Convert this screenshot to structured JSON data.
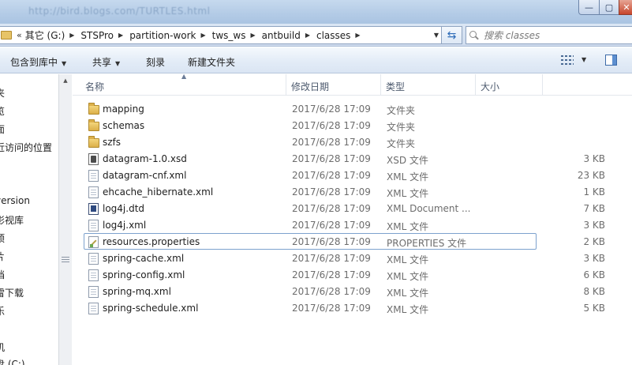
{
  "window": {
    "title": "http://bird.blogs.com/TURTLES.html",
    "controls": {
      "minimize": "—",
      "maximize": "▢",
      "close": "✕"
    }
  },
  "address": {
    "prefix": "«",
    "crumbs": [
      "其它 (G:)",
      "STSPro",
      "partition-work",
      "tws_ws",
      "antbuild",
      "classes"
    ]
  },
  "search": {
    "placeholder": "搜索 classes"
  },
  "toolbar": {
    "include_library": "包含到库中",
    "share": "共享",
    "burn": "刻录",
    "new_folder": "新建文件夹"
  },
  "nav": {
    "items": [
      "夹",
      "览",
      "面",
      "近访问的位置",
      "version",
      "影视库",
      "顶",
      "片",
      "档",
      "雷下载",
      "乐",
      "机",
      "盘 (C:)"
    ]
  },
  "columns": {
    "name": "名称",
    "date": "修改日期",
    "type": "类型",
    "size": "大小"
  },
  "files": [
    {
      "icon": "folder-icon",
      "name": "mapping",
      "date": "2017/6/28 17:09",
      "type": "文件夹",
      "size": ""
    },
    {
      "icon": "folder-icon",
      "name": "schemas",
      "date": "2017/6/28 17:09",
      "type": "文件夹",
      "size": ""
    },
    {
      "icon": "folder-icon",
      "name": "szfs",
      "date": "2017/6/28 17:09",
      "type": "文件夹",
      "size": ""
    },
    {
      "icon": "xsd-file-icon",
      "name": "datagram-1.0.xsd",
      "date": "2017/6/28 17:09",
      "type": "XSD 文件",
      "size": "3 KB"
    },
    {
      "icon": "xml-file-icon",
      "name": "datagram-cnf.xml",
      "date": "2017/6/28 17:09",
      "type": "XML 文件",
      "size": "23 KB"
    },
    {
      "icon": "xml-file-icon",
      "name": "ehcache_hibernate.xml",
      "date": "2017/6/28 17:09",
      "type": "XML 文件",
      "size": "1 KB"
    },
    {
      "icon": "dtd-file-icon",
      "name": "log4j.dtd",
      "date": "2017/6/28 17:09",
      "type": "XML Document ...",
      "size": "7 KB"
    },
    {
      "icon": "xml-file-icon",
      "name": "log4j.xml",
      "date": "2017/6/28 17:09",
      "type": "XML 文件",
      "size": "3 KB"
    },
    {
      "icon": "properties-file-icon",
      "name": "resources.properties",
      "date": "2017/6/28 17:09",
      "type": "PROPERTIES 文件",
      "size": "2 KB"
    },
    {
      "icon": "xml-file-icon",
      "name": "spring-cache.xml",
      "date": "2017/6/28 17:09",
      "type": "XML 文件",
      "size": "3 KB"
    },
    {
      "icon": "xml-file-icon",
      "name": "spring-config.xml",
      "date": "2017/6/28 17:09",
      "type": "XML 文件",
      "size": "6 KB"
    },
    {
      "icon": "xml-file-icon",
      "name": "spring-mq.xml",
      "date": "2017/6/28 17:09",
      "type": "XML 文件",
      "size": "8 KB"
    },
    {
      "icon": "xml-file-icon",
      "name": "spring-schedule.xml",
      "date": "2017/6/28 17:09",
      "type": "XML 文件",
      "size": "5 KB"
    }
  ]
}
